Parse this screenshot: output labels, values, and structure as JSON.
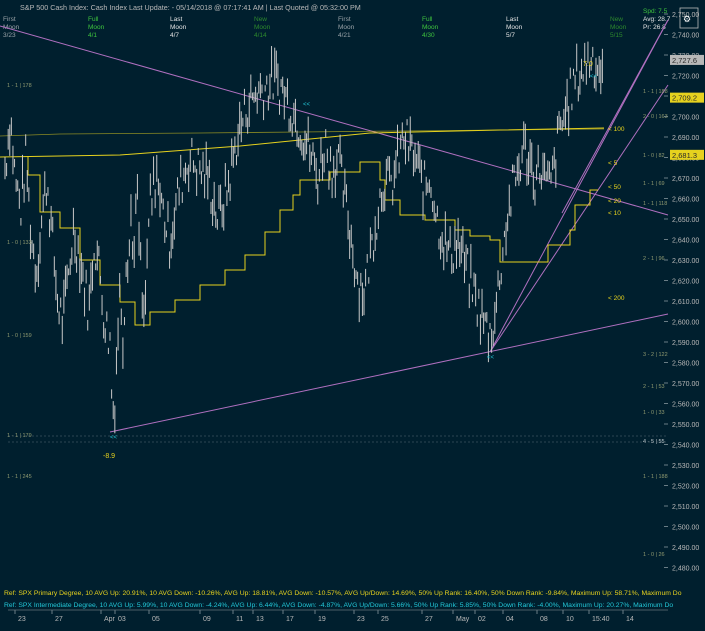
{
  "header": {
    "title": "S&P 500 Cash Index:  Cash Index  Last Update: - 05/14/2018 @ 07:17:41 AM | Last Quoted @ 05:32:00 PM",
    "moon_rows": [
      {
        "l1": "First",
        "l2": "Moon",
        "l3": "3/23",
        "c": "#9aa3a8"
      },
      {
        "l1": "Full",
        "l2": "Moon",
        "l3": "4/1",
        "c": "#3ec43e"
      },
      {
        "l1": "Last",
        "l2": "Moon",
        "l3": "4/7",
        "c": "#e4e4e4"
      },
      {
        "l1": "New",
        "l2": "Moon",
        "l3": "4/14",
        "c": "#2d8a2d"
      },
      {
        "l1": "First",
        "l2": "Moon",
        "l3": "4/21",
        "c": "#9aa3a8"
      },
      {
        "l1": "Full",
        "l2": "Moon",
        "l3": "4/30",
        "c": "#3ec43e"
      },
      {
        "l1": "Last",
        "l2": "Moon",
        "l3": "5/7",
        "c": "#e4e4e4"
      },
      {
        "l1": "New",
        "l2": "Moon",
        "l3": "5/15",
        "c": "#2d8a2d"
      }
    ],
    "corner": {
      "l1": "Spd: 7.5",
      "l2": "Avg: 28.7",
      "l3": "Pr: 26.8"
    }
  },
  "chart_data": {
    "type": "line",
    "ylim": [
      2470,
      2750
    ],
    "yticks": [
      2480,
      2490,
      2500,
      2510,
      2520,
      2530,
      2540,
      2550,
      2560,
      2570,
      2580,
      2590,
      2600,
      2610,
      2620,
      2630,
      2640,
      2650,
      2660,
      2670,
      2680,
      2690,
      2700,
      2710,
      2720,
      2730,
      2740,
      2750
    ],
    "xticks": [
      "23",
      "27",
      "Apr",
      "03",
      "05",
      "09",
      "11",
      "13",
      "17",
      "19",
      "23",
      "25",
      "27",
      "May",
      "02",
      "04",
      "08",
      "10",
      "15:40",
      "14"
    ],
    "price_path": [
      [
        2675,
        2700,
        2668,
        2655,
        2680,
        2640,
        2625,
        2650,
        2670,
        2640,
        2610,
        2600,
        2620,
        2645,
        2635,
        2620,
        2605,
        2640,
        2625,
        2600,
        2590
      ],
      [
        2590,
        2560,
        2555,
        2580,
        2600,
        2620,
        2590,
        2610,
        2640,
        2630,
        2655,
        2630,
        2650,
        2660,
        2640,
        2620,
        2595,
        2610,
        2635,
        2660,
        2650,
        2670,
        2655,
        2680,
        2660
      ],
      [
        2660,
        2640,
        2665,
        2680,
        2675,
        2670,
        2650,
        2665,
        2690,
        2705,
        2712,
        2715,
        2718,
        2710,
        2700,
        2690
      ],
      [
        2690,
        2680,
        2670,
        2688,
        2675,
        2680,
        2660,
        2640,
        2620,
        2615,
        2635,
        2655,
        2670,
        2665,
        2678,
        2690,
        2684,
        2676,
        2665,
        2670,
        2650,
        2640,
        2632,
        2640,
        2630,
        2620,
        2610,
        2600,
        2594
      ],
      [
        2594,
        2605,
        2630,
        2650,
        2665,
        2675,
        2685,
        2678,
        2670,
        2676,
        2665,
        2670,
        2690,
        2700,
        2710,
        2718,
        2722,
        2727,
        2729,
        2723,
        2726
      ]
    ],
    "last_price": "2,727.6",
    "price_labels": [
      "2,709.2",
      "2,681.3"
    ],
    "ma_labels": [
      "< 100",
      "< 5",
      "< 50",
      "< 20",
      "< 10",
      "< 200"
    ],
    "fib_labels_left": [
      "1 - 1 | 178",
      "1 - 0 | 133",
      "1 - 0 | 159",
      "1 - 1 | 179",
      "1 - 1 | 245"
    ],
    "fib_labels_right": [
      "1 - 1 | 188",
      "2 - 0 | 163",
      "1 - 0 | 82",
      "1 - 1 | 69",
      "1 - 1 | 118",
      "2 - 1 | 96",
      "3 - 2 | 122",
      "2 - 1 | 53",
      "1 - 0 | 33",
      "4 - 5 | 55",
      "1 - 1 | 188",
      "1 - 0 | 26"
    ],
    "annotations": {
      "high": "7.0",
      "low": "-8.9"
    },
    "footer_lines": [
      "Ref: SPX Primary Degree, 10 AVG Up: 20.91%, 10 AVG Down: -10.26%, AVG Up: 18.81%, AVG Down: -10.57%, AVG Up/Down: 14.69%, 50%  Up Rank: 16.40%, 50% Down Rank: -9.84%, Maximum Up: 58.71%, Maximum Do",
      "Ref: SPX Intermediate Degree, 10 AVG Up: 5.99%, 10 AVG Down: -4.24%, AVG Up: 6.44%, AVG Down: -4.87%, AVG Up/Down: 5.66%, 50%  Up Rank: 5.85%, 50% Down Rank: -4.00%, Maximum Up: 20.27%, Maximum Do"
    ]
  },
  "colors": {
    "bg": "#001f2e",
    "price": "#c8c8c8",
    "ma": "#e6d21e",
    "trend": "#b070c0",
    "axis_text": "#b8b8b8",
    "label_yellow": "#e6d21e",
    "label_cyan": "#22c8d8",
    "fib_text": "#8f9a70",
    "grid": "#0e3a4c"
  }
}
